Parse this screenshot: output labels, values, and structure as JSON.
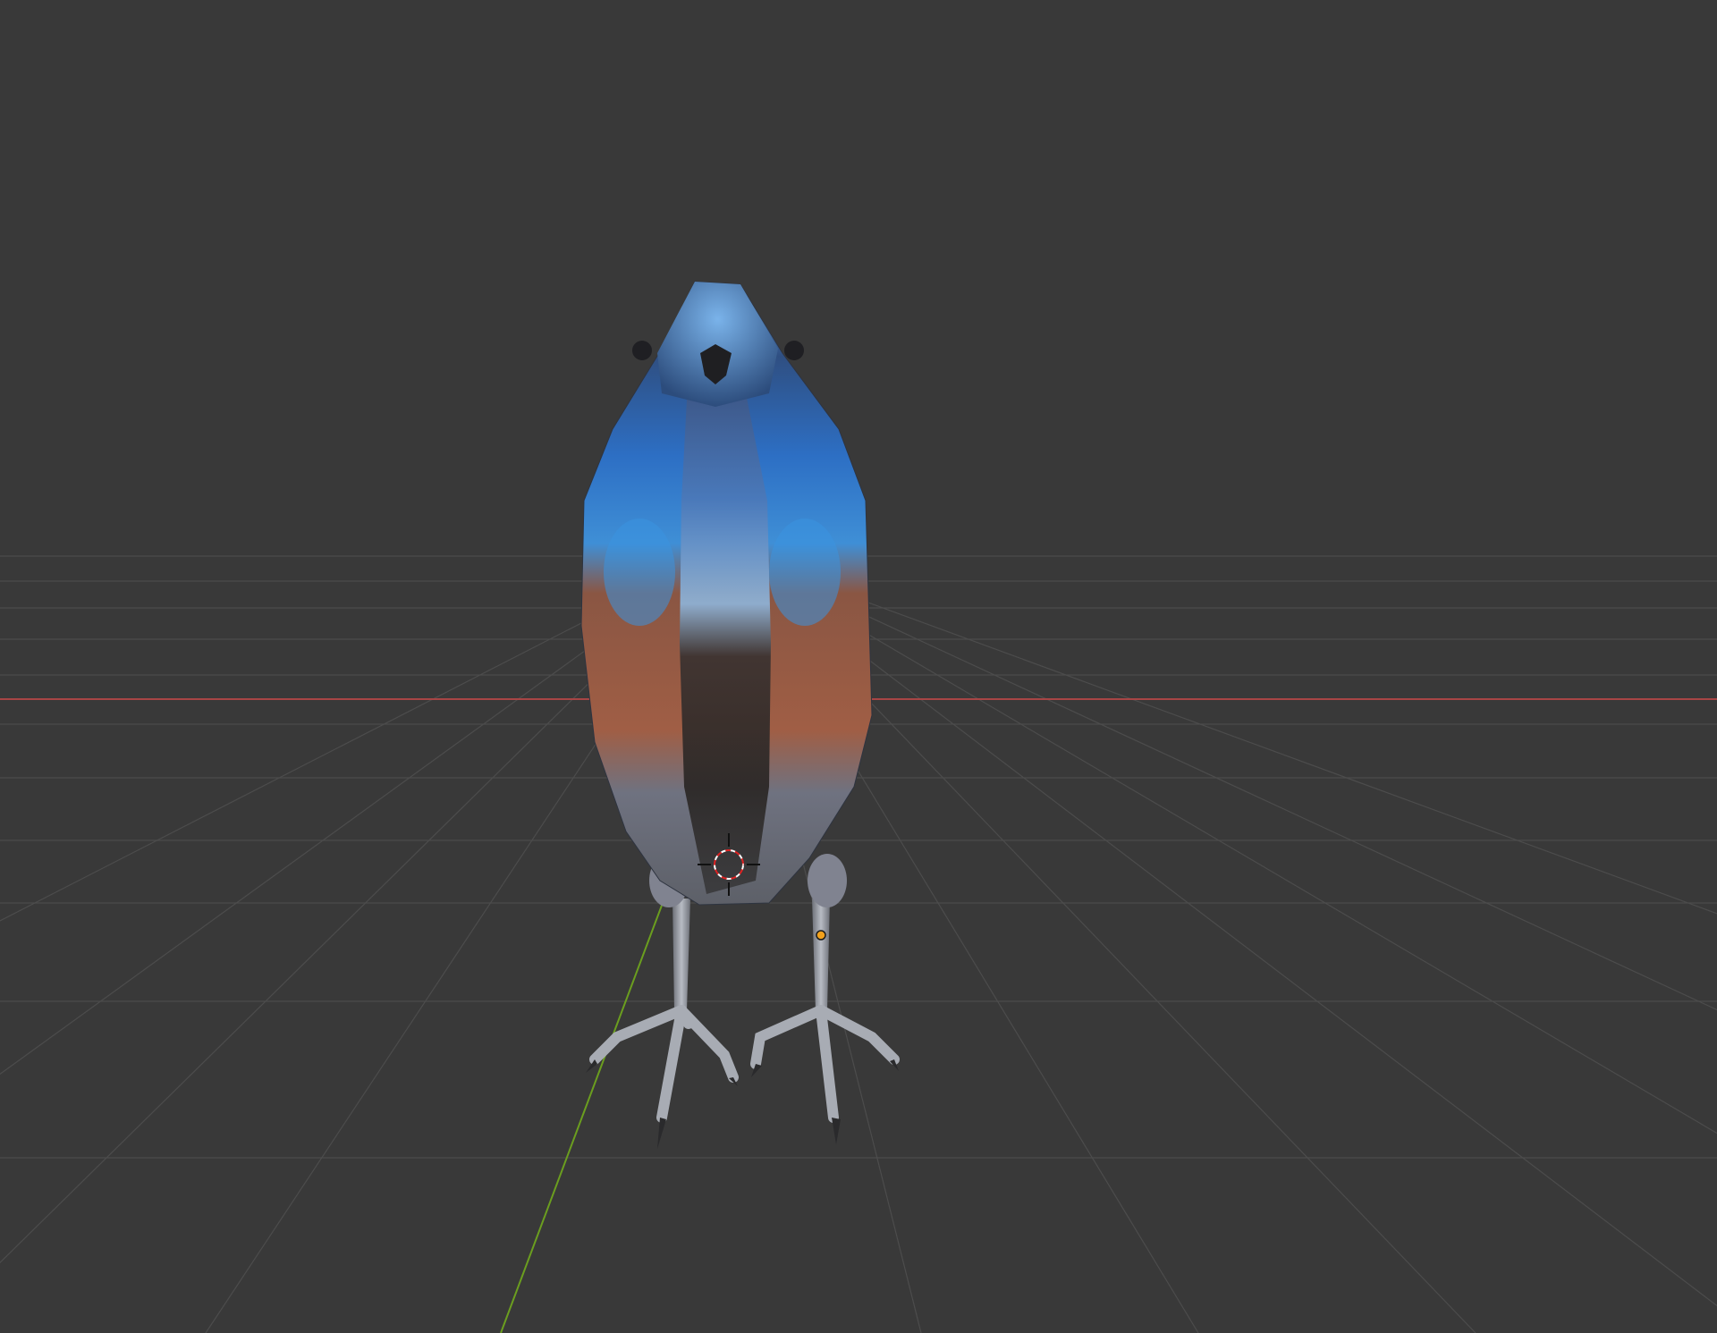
{
  "viewport": {
    "background_color": "#393939",
    "grid_color": "#4a4a4a",
    "x_axis_color": "#b34848",
    "y_axis_color": "#6a9a1e"
  },
  "scene": {
    "object": "bird-model",
    "body_colors": {
      "blue": "#2d6fc4",
      "light_blue": "#4fa3e0",
      "rust": "#9a5a44",
      "dark": "#2a2522",
      "gray": "#8a8d95"
    },
    "cursor_icon": "3d-cursor-icon",
    "origin_icon": "object-origin-icon",
    "origin_color": "#f2a11c"
  }
}
